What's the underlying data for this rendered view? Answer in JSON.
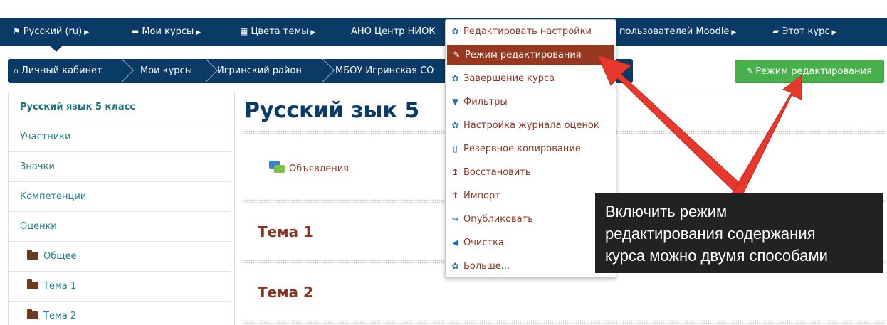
{
  "topnav": {
    "language": "Русский ‎(ru)‎",
    "my_courses": "Мои курсы",
    "theme_colors": "Цвета темы",
    "org": "АНО Центр НИОК",
    "moodle_users": "пользователей Moodle",
    "this_course": "Этот курс"
  },
  "breadcrumb": {
    "items": [
      "Личный кабинет",
      "Мои курсы",
      "Игринский район",
      "МБОУ Игринская СО"
    ]
  },
  "edit_button": {
    "label": "Режим редактирования"
  },
  "sidebar": {
    "items": [
      "Русский язык 5 класс",
      "Участники",
      "Значки",
      "Компетенции",
      "Оценки",
      "Общее",
      "Тема 1",
      "Тема 2"
    ]
  },
  "main": {
    "title": "Русский зык 5",
    "forum_label": "Объявления",
    "sections": [
      "Тема 1",
      "Тема 2"
    ]
  },
  "dropdown": {
    "items": [
      {
        "label": "Редактировать настройки",
        "icon": "gear-icon"
      },
      {
        "label": "Режим редактирования",
        "icon": "pencil-icon"
      },
      {
        "label": "Завершение курса",
        "icon": "gear-icon"
      },
      {
        "label": "Фильтры",
        "icon": "filter-icon"
      },
      {
        "label": "Настройка журнала оценок",
        "icon": "gear-icon"
      },
      {
        "label": "Резервное копирование",
        "icon": "file-archive-icon"
      },
      {
        "label": "Восстановить",
        "icon": "upload-icon"
      },
      {
        "label": "Импорт",
        "icon": "upload-icon"
      },
      {
        "label": "Опубликовать",
        "icon": "share-icon"
      },
      {
        "label": "Очистка",
        "icon": "arrow-left-icon"
      },
      {
        "label": "Больше...",
        "icon": "gear-icon"
      }
    ]
  },
  "annotation": {
    "lines": [
      "Включить режим",
      "редактирования содержания",
      "курса можно двумя способами"
    ]
  },
  "colors": {
    "navbar": "#0a3a66",
    "accent_red": "#963820",
    "green": "#48b04b",
    "arrow": "#e8372c"
  }
}
